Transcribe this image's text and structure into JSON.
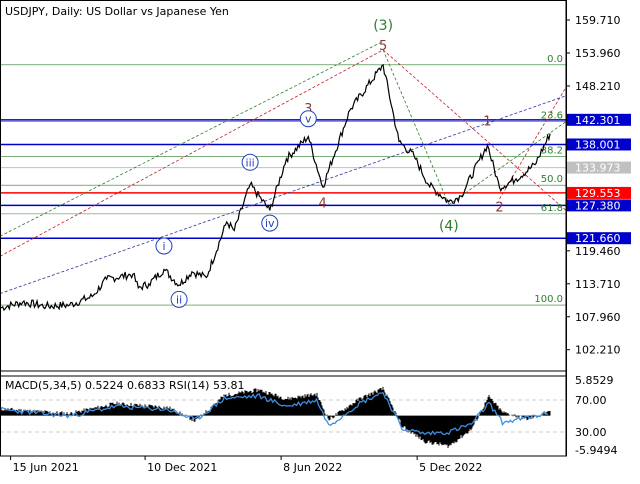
{
  "header": {
    "symbol": "USDJPY",
    "timeframe": "Daily",
    "description": "US Dollar vs Japanese Yen"
  },
  "colors": {
    "price_line": "#000000",
    "axis": "#000000",
    "fib": "#2e7d2e",
    "level_blue": "#0000cc",
    "level_red": "#ff0000",
    "level_grey": "#c0c0c0",
    "wave_green": "#2e7d2e",
    "wave_brown": "#8b3a3a",
    "wave_blue": "#1f3fbf",
    "channel_blue": "#3030a0",
    "channel_red": "#c02020",
    "macd_hist": "#000000",
    "rsi_line": "#3b8fe0"
  },
  "chart_data": [
    {
      "type": "line",
      "title": "USDJPY, Daily:  US Dollar vs Japanese Yen",
      "ylim": [
        98.5,
        162.5
      ],
      "y_ticks": [
        "159.710",
        "153.960",
        "148.210",
        "142.301",
        "138.001",
        "133.973",
        "129.553",
        "127.380",
        "121.660",
        "119.460",
        "113.710",
        "107.960",
        "102.210"
      ],
      "x_ticks": [
        "15 Jun 2021",
        "10 Dec 2021",
        "8 Jun 2022",
        "5 Dec 2022"
      ],
      "x_range": [
        "2021-06-01",
        "2023-06-20"
      ],
      "series": [
        {
          "x": [
            "2021-06-01",
            "2021-07-01",
            "2021-08-01",
            "2021-09-01",
            "2021-10-01",
            "2021-10-20",
            "2021-11-24",
            "2021-12-01",
            "2021-12-15",
            "2022-01-04",
            "2022-01-24",
            "2022-02-10",
            "2022-03-01",
            "2022-03-28",
            "2022-04-07",
            "2022-04-28",
            "2022-05-24",
            "2022-06-15",
            "2022-07-14",
            "2022-08-02",
            "2022-09-07",
            "2022-10-21",
            "2022-11-11",
            "2022-12-01",
            "2022-12-20",
            "2023-01-16",
            "2023-02-01",
            "2023-03-08",
            "2023-03-24",
            "2023-04-15",
            "2023-05-10",
            "2023-05-30"
          ],
          "y": [
            109.5,
            110.5,
            109.8,
            110.0,
            111.5,
            114.5,
            115.4,
            113.0,
            113.7,
            116.2,
            113.5,
            115.8,
            114.8,
            124.5,
            123.0,
            131.0,
            126.5,
            135.5,
            139.4,
            130.6,
            144.0,
            151.9,
            138.5,
            136.0,
            131.0,
            128.0,
            129.0,
            137.9,
            130.5,
            132.0,
            134.5,
            139.9
          ]
        }
      ],
      "horizontal_levels": [
        {
          "value": 142.301,
          "label": "142.301",
          "kind": "blue"
        },
        {
          "value": 138.001,
          "label": "138.001",
          "kind": "blue"
        },
        {
          "value": 133.973,
          "label": "133.973",
          "kind": "grey"
        },
        {
          "value": 129.553,
          "label": "129.553",
          "kind": "red"
        },
        {
          "value": 127.38,
          "label": "127.380",
          "kind": "blue"
        },
        {
          "value": 121.66,
          "label": "121.660",
          "kind": "blue"
        }
      ],
      "fibonacci": [
        {
          "label": "0.0",
          "value": 151.9
        },
        {
          "label": "23.6",
          "value": 142.0
        },
        {
          "label": "38.2",
          "value": 135.9
        },
        {
          "label": "50.0",
          "value": 130.9
        },
        {
          "label": "61.8",
          "value": 125.9
        },
        {
          "label": "100.0",
          "value": 110.0
        }
      ],
      "wave_labels": [
        {
          "text": "(3)",
          "x": "2022-10-21",
          "y": 158.0,
          "color": "green",
          "circled": false
        },
        {
          "text": "5",
          "x": "2022-10-21",
          "y": 154.5,
          "color": "brown",
          "circled": false
        },
        {
          "text": "(4)",
          "x": "2023-01-16",
          "y": 123.0,
          "color": "green",
          "circled": false
        },
        {
          "text": "1",
          "x": "2023-03-08",
          "y": 141.3,
          "color": "brown",
          "circled": false
        },
        {
          "text": "2",
          "x": "2023-03-24",
          "y": 126.3,
          "color": "brown",
          "circled": false
        },
        {
          "text": "3",
          "x": "2022-07-14",
          "y": 143.5,
          "color": "brown",
          "circled": false
        },
        {
          "text": "4",
          "x": "2022-08-02",
          "y": 127.0,
          "color": "brown",
          "circled": false
        },
        {
          "text": "i",
          "x": "2022-01-04",
          "y": 119.6,
          "color": "blue",
          "circled": true
        },
        {
          "text": "ii",
          "x": "2022-01-24",
          "y": 110.3,
          "color": "blue",
          "circled": true
        },
        {
          "text": "iii",
          "x": "2022-04-28",
          "y": 134.2,
          "color": "blue",
          "circled": true
        },
        {
          "text": "iv",
          "x": "2022-05-24",
          "y": 123.6,
          "color": "blue",
          "circled": true
        },
        {
          "text": "v",
          "x": "2022-07-14",
          "y": 141.8,
          "color": "blue",
          "circled": true
        }
      ],
      "trend_lines": [
        {
          "color": "red",
          "x": [
            "2021-06-01",
            "2022-10-21"
          ],
          "y": [
            118.5,
            154.5
          ]
        },
        {
          "color": "red",
          "x": [
            "2022-10-21",
            "2023-06-20"
          ],
          "y": [
            154.5,
            126.5
          ]
        },
        {
          "color": "red",
          "x": [
            "2023-03-24",
            "2023-06-20"
          ],
          "y": [
            128.5,
            148.0
          ]
        },
        {
          "color": "blue",
          "x": [
            "2021-06-01",
            "2023-06-20"
          ],
          "y": [
            112.0,
            146.5
          ]
        },
        {
          "color": "green",
          "x": [
            "2021-06-01",
            "2022-10-21"
          ],
          "y": [
            122.0,
            156.0
          ]
        },
        {
          "color": "green",
          "x": [
            "2022-10-21",
            "2023-01-16"
          ],
          "y": [
            154.5,
            127.5
          ]
        },
        {
          "color": "green",
          "x": [
            "2023-01-16",
            "2023-06-20"
          ],
          "y": [
            127.5,
            142.0
          ]
        }
      ]
    },
    {
      "type": "area",
      "title": "MACD(5,34,5) 0.5224 0.6833 RSI(14) 53.81",
      "ylim": [
        -5.9494,
        5.8529
      ],
      "y_ticks": [
        "5.8529",
        "70.00",
        "30.00",
        "-5.9494"
      ],
      "series": [
        {
          "name": "MACD(5,34,5)",
          "x": [
            "2021-06-01",
            "2021-09-01",
            "2021-11-01",
            "2022-01-10",
            "2022-02-15",
            "2022-03-25",
            "2022-05-10",
            "2022-06-15",
            "2022-07-25",
            "2022-08-10",
            "2022-09-20",
            "2022-10-21",
            "2022-11-15",
            "2022-12-15",
            "2023-01-16",
            "2023-02-15",
            "2023-03-10",
            "2023-03-28",
            "2023-05-01",
            "2023-05-30"
          ],
          "y": [
            1.0,
            0.3,
            1.8,
            1.2,
            -0.8,
            3.0,
            3.8,
            2.5,
            3.2,
            -0.6,
            2.5,
            4.0,
            -1.5,
            -3.8,
            -4.5,
            -2.0,
            2.8,
            0.5,
            -0.5,
            0.5
          ]
        },
        {
          "name": "RSI(14)",
          "x": [
            "2021-06-01",
            "2021-09-01",
            "2021-11-01",
            "2022-01-10",
            "2022-02-15",
            "2022-03-25",
            "2022-05-10",
            "2022-06-15",
            "2022-07-25",
            "2022-08-10",
            "2022-09-20",
            "2022-10-21",
            "2022-11-15",
            "2022-12-15",
            "2023-01-16",
            "2023-02-15",
            "2023-03-10",
            "2023-03-28",
            "2023-05-01",
            "2023-05-30"
          ],
          "y": [
            58,
            50,
            62,
            58,
            45,
            72,
            75,
            62,
            70,
            38,
            66,
            80,
            34,
            28,
            30,
            40,
            66,
            42,
            48,
            54
          ]
        }
      ]
    }
  ]
}
